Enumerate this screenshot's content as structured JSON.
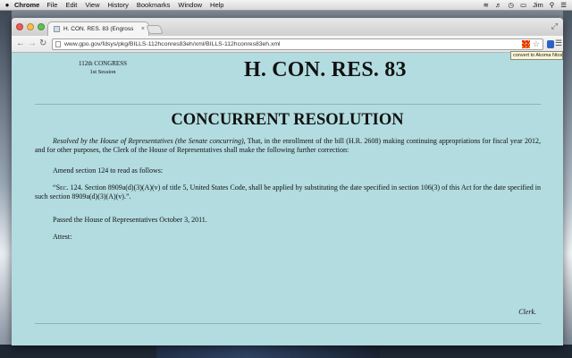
{
  "menubar": {
    "apple": "",
    "app_name": "Chrome",
    "items": [
      "File",
      "Edit",
      "View",
      "History",
      "Bookmarks",
      "Window",
      "Help"
    ],
    "user": "Jim"
  },
  "browser": {
    "tab_title": "H. CON. RES. 83 (Engross",
    "url": "www.gpo.gov/fdsys/pkg/BILLS-112hconres83eh/xml/BILLS-112hconres83eh.xml",
    "tooltip": "convert to Akoma Ntoso"
  },
  "document": {
    "congress": "112th CONGRESS",
    "session": "1st Session",
    "resolution_number": "H. CON. RES. 83",
    "doc_type": "CONCURRENT RESOLUTION",
    "resolved_italic": "Resolved by the House of Representatives (the Senate concurring)",
    "resolved_text": ", That, in the enrollment of the bill (H.R. 2608) making continuing appropriations for fiscal year 2012, and for other purposes, the Clerk of the House of Representatives shall make the following further correction:",
    "amend_text": "Amend section 124 to read as follows:",
    "section_quote_open": "“",
    "section_label": "Sec. 124.",
    "section_text": " Section 8909a(d)(3)(A)(v) of title 5, United States Code, shall be applied by substituting the date specified in section 106(3) of this Act for the date specified in such section 8909a(d)(3)(A)(v).”.",
    "passed_text": "Passed the House of Representatives October 3, 2011.",
    "attest_text": "Attest:",
    "clerk_text": "Clerk."
  }
}
